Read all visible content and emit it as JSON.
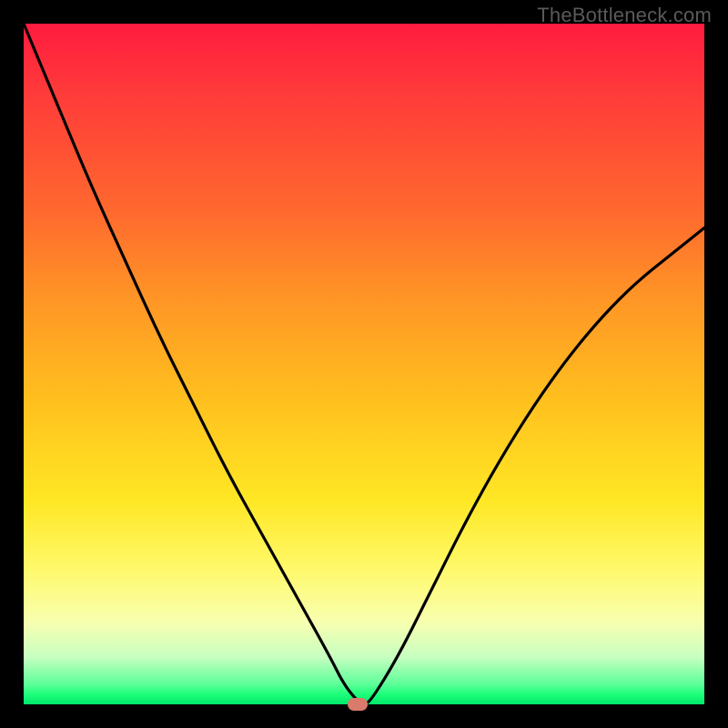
{
  "watermark": "TheBottleneck.com",
  "chart_data": {
    "type": "line",
    "title": "",
    "xlabel": "",
    "ylabel": "",
    "xlim": [
      0,
      100
    ],
    "ylim": [
      0,
      100
    ],
    "series": [
      {
        "name": "curve",
        "x": [
          0,
          5,
          10,
          15,
          20,
          25,
          30,
          35,
          40,
          45,
          47,
          49,
          50,
          51,
          55,
          60,
          65,
          70,
          75,
          80,
          85,
          90,
          95,
          100
        ],
        "values": [
          100,
          88,
          76,
          65,
          54,
          44,
          34,
          25,
          16,
          7,
          3,
          0.5,
          0,
          0.5,
          7,
          17,
          27,
          36,
          44,
          51,
          57,
          62,
          66,
          70
        ]
      }
    ],
    "marker": {
      "x": 49,
      "y": 0
    },
    "grid": false,
    "legend": false
  },
  "colors": {
    "curve": "#000000",
    "marker": "#d97a6c",
    "background_top": "#ff1b3f",
    "background_bottom": "#00e86b",
    "frame": "#000000"
  }
}
